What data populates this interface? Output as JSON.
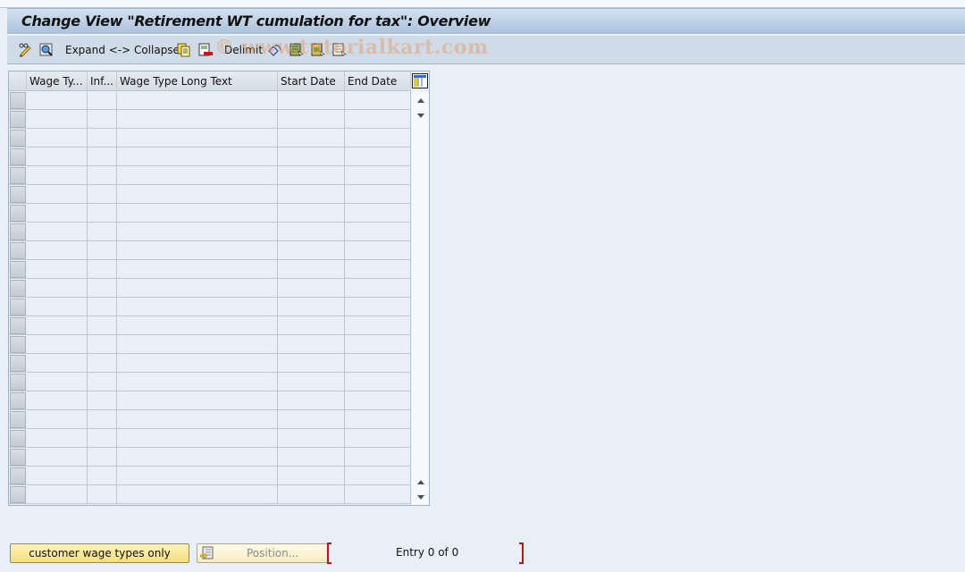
{
  "window": {
    "title": "Change View \"Retirement WT cumulation for tax\": Overview"
  },
  "toolbar": {
    "items": [
      {
        "name": "display-change-icon",
        "label": ""
      },
      {
        "name": "find-icon",
        "label": ""
      },
      {
        "name": "expand-collapse",
        "label": "Expand <-> Collapse"
      },
      {
        "name": "copy-icon",
        "label": ""
      },
      {
        "name": "delete-icon",
        "label": ""
      },
      {
        "name": "delimit",
        "label": "Delimit"
      },
      {
        "name": "undo-icon",
        "label": ""
      },
      {
        "name": "select-all-icon",
        "label": ""
      },
      {
        "name": "select-block-icon",
        "label": ""
      },
      {
        "name": "deselect-all-icon",
        "label": ""
      }
    ],
    "watermark": "© www.tutorialkart.com"
  },
  "table": {
    "columns": [
      "Wage Ty...",
      "Inf...",
      "Wage Type Long Text",
      "Start Date",
      "End Date"
    ],
    "row_count_visible": 22,
    "rows": []
  },
  "footer": {
    "customer_button": "customer wage types only",
    "position_button": "Position...",
    "entry_text": "Entry 0 of 0"
  },
  "colors": {
    "background": "#e8eff7",
    "titlebar": "#a9c2dc",
    "toolbar": "#cfdbe6",
    "button_yellow": "#f5de7a",
    "bracket_red": "#c8101a"
  }
}
